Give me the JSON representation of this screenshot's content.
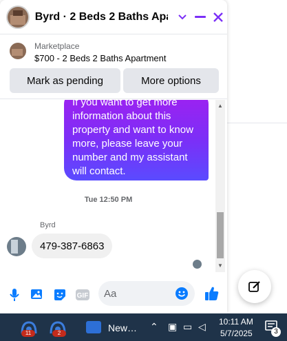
{
  "chat": {
    "title": "Byrd · 2 Beds 2 Baths Apar…",
    "listing": {
      "marketplace_label": "Marketplace",
      "title": "$700 - 2 Beds 2 Baths Apartment",
      "pending_button": "Mark as pending",
      "more_button": "More options"
    },
    "messages": {
      "outgoing_text": "If you want to get more information about this property and want to know more, please leave your number and my assistant will contact.",
      "timestamp": "Tue 12:50 PM",
      "sender_name": "Byrd",
      "incoming_text": "479-387-6863"
    },
    "composer": {
      "placeholder": "Aa",
      "gif_label": "GIF"
    }
  },
  "taskbar": {
    "app_badge_1": "11",
    "app_badge_2": "2",
    "news_label": "New…",
    "time": "10:11 AM",
    "date": "5/7/2025",
    "notification_count": "3"
  },
  "colors": {
    "accent": "#7b2ff7",
    "messenger_blue": "#0a7cff",
    "taskbar": "#1f3349"
  }
}
